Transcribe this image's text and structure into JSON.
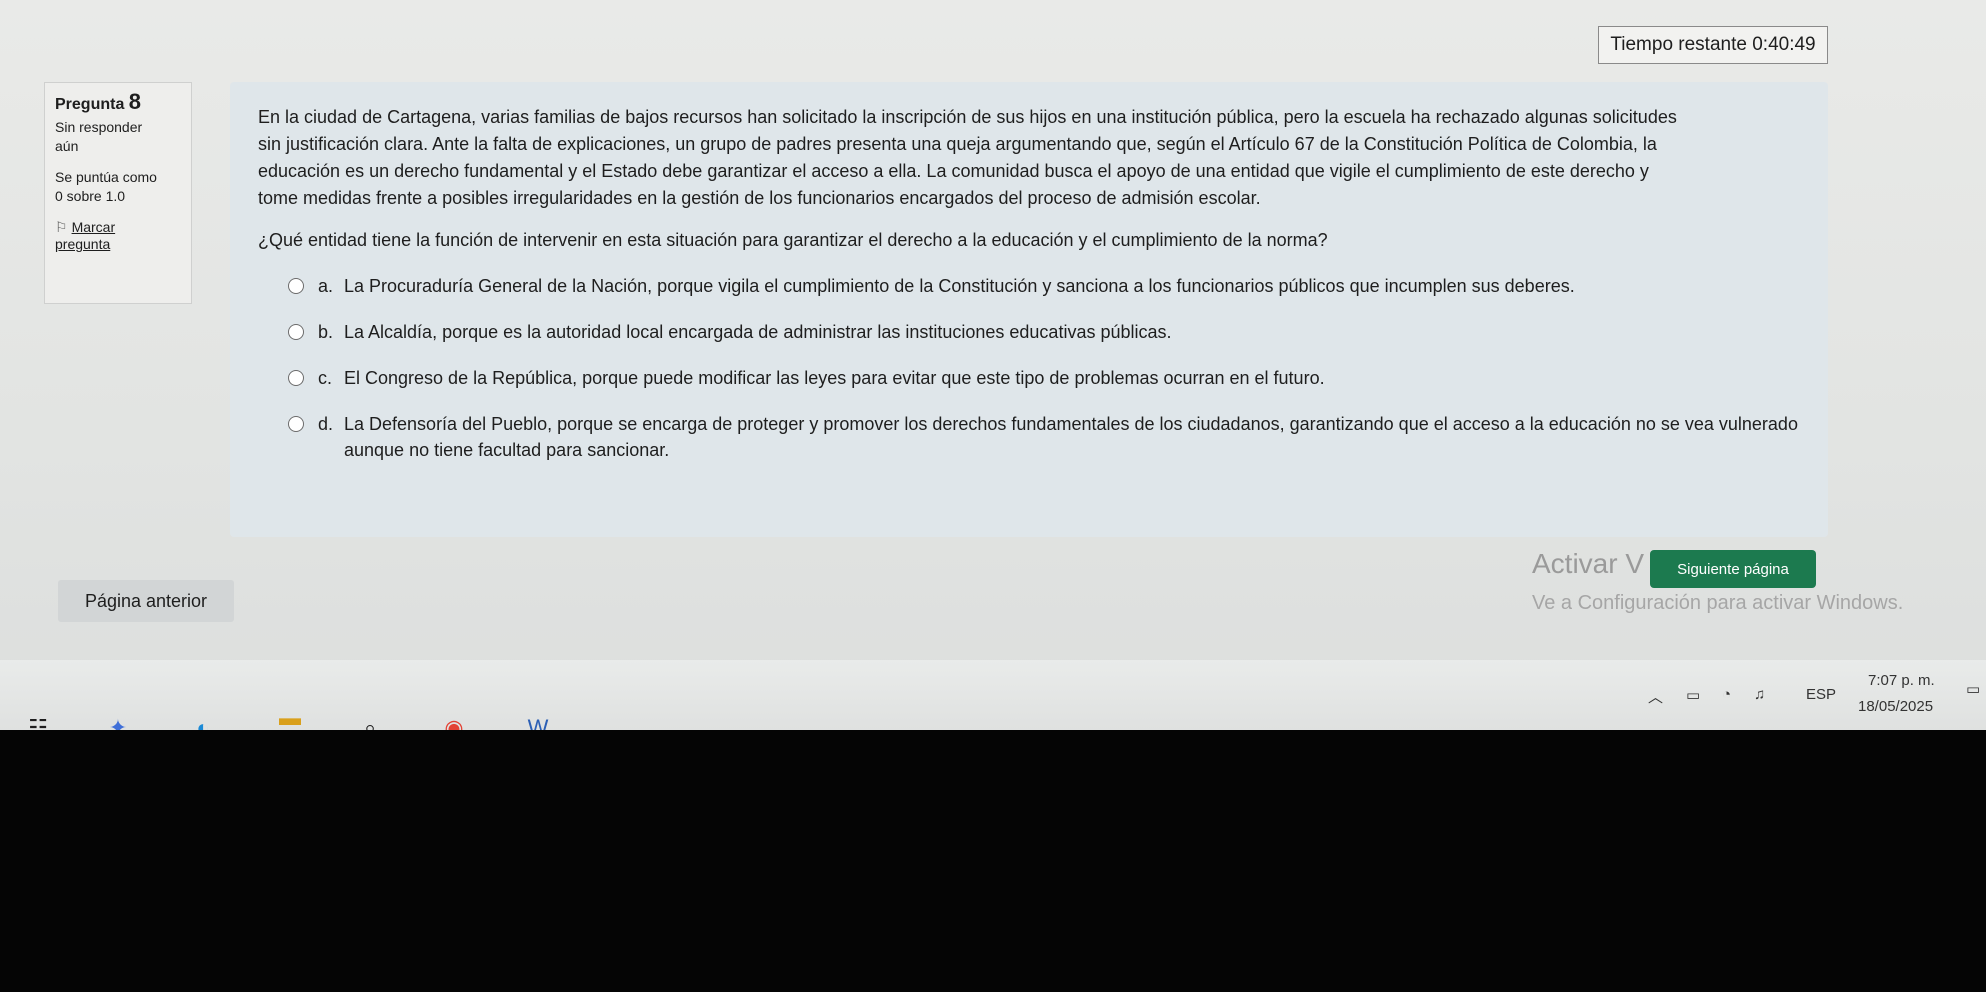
{
  "timer": {
    "label": "Tiempo restante 0:40:49"
  },
  "question_info": {
    "label": "Pregunta",
    "number": "8",
    "status": [
      "Sin responder",
      "aún"
    ],
    "score": [
      "Se puntúa como",
      "0 sobre 1.0"
    ],
    "flag_label": "Marcar",
    "flag_label_2": "pregunta"
  },
  "question": {
    "lines": [
      "En la ciudad de Cartagena, varias familias de bajos recursos han solicitado la inscripción de sus hijos en una institución pública, pero la escuela ha rechazado algunas solicitudes",
      "sin justificación clara. Ante la falta de explicaciones, un grupo de padres presenta una queja argumentando que, según el Artículo 67 de la Constitución Política de Colombia, la",
      "educación es un derecho fundamental y el Estado debe garantizar el acceso a ella. La comunidad busca el apoyo de una entidad que vigile el cumplimiento de este derecho y",
      "tome medidas frente a posibles irregularidades en la gestión de los funcionarios encargados del proceso de admisión escolar."
    ],
    "prompt": "¿Qué entidad tiene la función de intervenir en esta situación para garantizar el derecho a la educación y el cumplimiento de la norma?"
  },
  "answers": [
    {
      "letter": "a.",
      "text": "La Procuraduría General de la Nación, porque vigila el cumplimiento de la Constitución y sanciona a los funcionarios públicos que incumplen sus deberes."
    },
    {
      "letter": "b.",
      "text": "La Alcaldía, porque es la autoridad local encargada de administrar las instituciones educativas públicas."
    },
    {
      "letter": "c.",
      "text": "El Congreso de la República, porque puede modificar las leyes para evitar que este tipo de problemas ocurran en el futuro."
    },
    {
      "letter": "d.",
      "text": "La Defensoría del Pueblo, porque se encarga de proteger y promover los derechos fundamentales de los ciudadanos, garantizando que el acceso a la educación no se vea vulnerado aunque no tiene facultad para sancionar."
    }
  ],
  "nav": {
    "prev": "Página anterior",
    "next": "Siguiente página"
  },
  "watermark": {
    "title": "Activar V",
    "subtitle": "Ve a Configuración para activar Windows."
  },
  "tray": {
    "lang": "ESP",
    "time": "7:07 p. m.",
    "date": "18/05/2025"
  }
}
